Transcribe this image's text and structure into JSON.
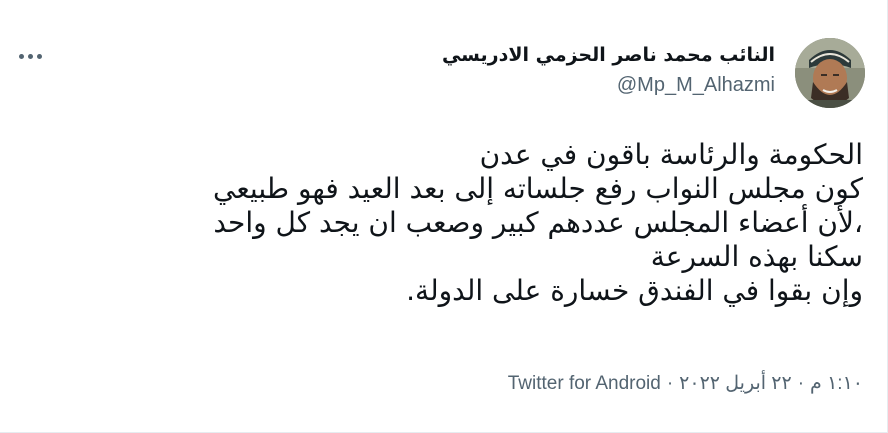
{
  "author": {
    "display_name": "النائب محمد ناصر الحزمي الادريسي",
    "handle": "@Mp_M_Alhazmi",
    "avatar_icon": "user-avatar"
  },
  "tweet": {
    "lines": [
      "الحكومة والرئاسة باقون في عدن",
      "كون مجلس النواب رفع جلساته إلى بعد العيد فهو طبيعي",
      "،لأن أعضاء المجلس عددهم كبير وصعب ان يجد كل واحد",
      "سكنا بهذه السرعة",
      "وإن بقوا في الفندق خسارة على الدولة."
    ]
  },
  "meta": {
    "time": "١:١٠ م",
    "separator": "·",
    "date": "٢٢ أبريل ٢٠٢٢",
    "source": "Twitter for Android"
  },
  "more_icon": "more-options-icon",
  "colors": {
    "text": "#0f1419",
    "muted": "#536471",
    "border": "#e6ecf0"
  }
}
